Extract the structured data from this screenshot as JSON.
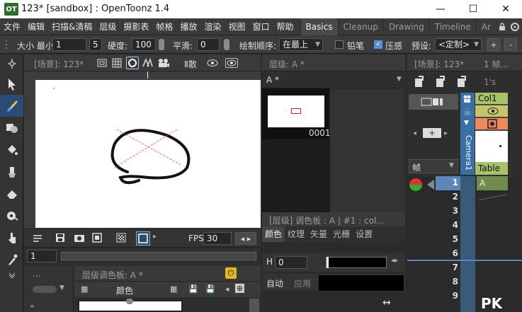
{
  "window": {
    "title": "123* [sandbox] : OpenToonz 1.4",
    "logo": "OT",
    "minimize": "—",
    "maximize": "☐",
    "close": "✕"
  },
  "menu": {
    "items": [
      "文件",
      "编辑",
      "扫描&清稿",
      "层级",
      "摄影表",
      "帧格",
      "播放",
      "渲染",
      "视图",
      "窗口",
      "帮助"
    ],
    "rooms": [
      "Basics",
      "Cleanup",
      "Drawing",
      "Timeline",
      "Ar"
    ],
    "active_room": "Basics",
    "overflow": "‹",
    "lock_icon": "lock-icon",
    "more": "›"
  },
  "tool_options": {
    "size_label": "大小 最小",
    "size_min": "1",
    "size_max": "5",
    "hardness_label": "硬度:",
    "hardness_value": "100",
    "smooth_label": "平滑:",
    "smooth_value": "0",
    "draw_order_label": "绘制顺序:",
    "draw_order_value": "在最上",
    "pencil_label": "铅笔",
    "pencil_checked": false,
    "pressure_label": "压感",
    "pressure_checked": true,
    "preset_label": "预设:",
    "preset_value": "<定制>",
    "add_label": "+",
    "remove_label": "-"
  },
  "viewer": {
    "header": "[场景]: 123*",
    "header_extra": "Ⅱ散",
    "fps_label": "FPS",
    "fps_value": "30",
    "frame_value": "1",
    "frame_start": "1"
  },
  "level_strip": {
    "header": "层级: A *",
    "level_name": "A *",
    "frame_label": "0001"
  },
  "style_editor": {
    "header": "[层级] 调色板 : A | #1 : col...",
    "tabs": [
      "颜色",
      "纹理",
      "矢量",
      "光栅",
      "设置"
    ],
    "active_tab": "颜色",
    "h_label": "H",
    "h_value": "0",
    "auto_label": "自动",
    "apply_label": "应用"
  },
  "palette_panel": {
    "dots": "...",
    "header": "层级调色板: A *",
    "color_label": "颜色"
  },
  "xsheet": {
    "header": "[场景]: 123*",
    "frame_header": "1 帧...",
    "seconds": "1's",
    "frame_dropdown": "帧",
    "column_name": "Col1",
    "camera_label": "Camera1",
    "table_label": "Table",
    "cell_value": "A",
    "rows": [
      "1",
      "2",
      "3",
      "4",
      "5",
      "6",
      "7",
      "8",
      "9"
    ],
    "watermark": "PK"
  }
}
